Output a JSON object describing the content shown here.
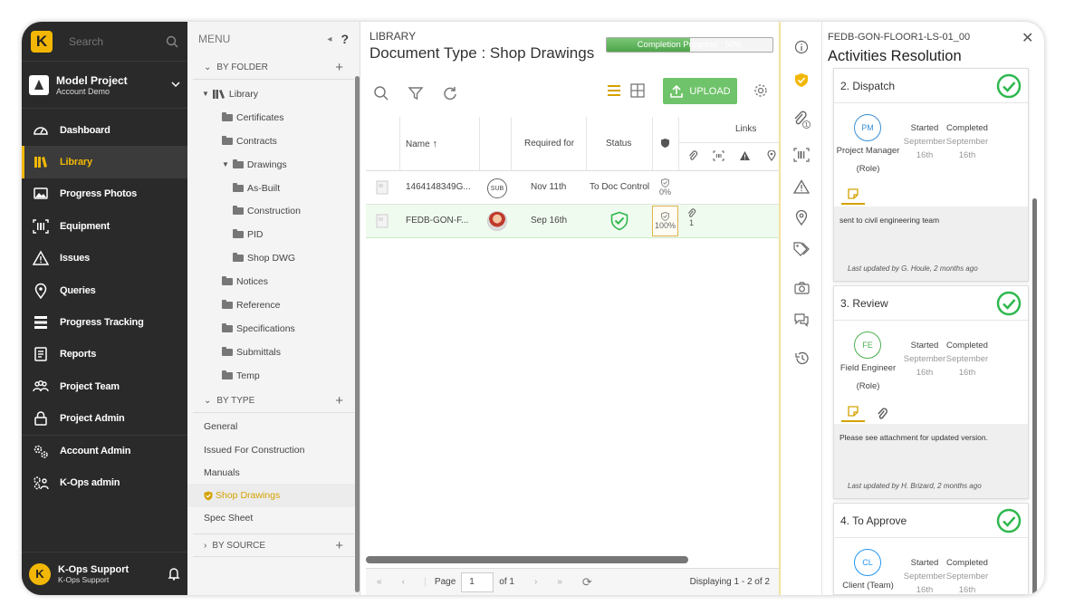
{
  "sidebar": {
    "search_placeholder": "Search",
    "logo_letter": "K",
    "project": {
      "name": "Model Project",
      "account": "Account Demo"
    },
    "items": [
      {
        "label": "Dashboard",
        "icon": "dashboard-icon"
      },
      {
        "label": "Library",
        "icon": "library-icon",
        "active": true
      },
      {
        "label": "Progress Photos",
        "icon": "photos-icon"
      },
      {
        "label": "Equipment",
        "icon": "barcode-icon"
      },
      {
        "label": "Issues",
        "icon": "warning-icon"
      },
      {
        "label": "Queries",
        "icon": "location-pin-icon"
      },
      {
        "label": "Progress Tracking",
        "icon": "tracking-icon"
      },
      {
        "label": "Reports",
        "icon": "report-icon"
      },
      {
        "label": "Project Team",
        "icon": "team-icon"
      },
      {
        "label": "Project Admin",
        "icon": "lock-icon"
      },
      {
        "label": "Account Admin",
        "icon": "gears-icon"
      },
      {
        "label": "K-Ops admin",
        "icon": "gears-users-icon"
      }
    ],
    "footer": {
      "name": "K-Ops Support",
      "sub": "K-Ops Support",
      "avatar": "K"
    }
  },
  "menu": {
    "title": "MENU",
    "help": "?",
    "by_folder": "BY FOLDER",
    "folders": [
      {
        "label": "Library",
        "depth": 0,
        "open": true
      },
      {
        "label": "Certificates",
        "depth": 1
      },
      {
        "label": "Contracts",
        "depth": 1
      },
      {
        "label": "Drawings",
        "depth": 1,
        "open": true
      },
      {
        "label": "As-Built",
        "depth": 2
      },
      {
        "label": "Construction",
        "depth": 2
      },
      {
        "label": "PID",
        "depth": 2
      },
      {
        "label": "Shop DWG",
        "depth": 2
      },
      {
        "label": "Notices",
        "depth": 1
      },
      {
        "label": "Reference",
        "depth": 1
      },
      {
        "label": "Specifications",
        "depth": 1
      },
      {
        "label": "Submittals",
        "depth": 1
      },
      {
        "label": "Temp",
        "depth": 1
      }
    ],
    "by_type": "BY TYPE",
    "types": [
      {
        "label": "General"
      },
      {
        "label": "Issued For Construction"
      },
      {
        "label": "Manuals"
      },
      {
        "label": "Shop Drawings",
        "active": true
      },
      {
        "label": "Spec Sheet"
      }
    ],
    "by_source": "BY SOURCE"
  },
  "library": {
    "label": "LIBRARY",
    "title": "Document Type : Shop Drawings",
    "completion": {
      "label": "Completion Progress : 50%",
      "value": 0.5
    },
    "upload": "UPLOAD",
    "columns": {
      "name": "Name",
      "required_for": "Required for",
      "status": "Status",
      "links": "Links"
    },
    "rows": [
      {
        "name": "1464148349G...",
        "badge": "SUB",
        "required": "Nov 11th",
        "status": "To Doc Control",
        "pct": "0%",
        "links": ""
      },
      {
        "name": "FEDB-GON-F...",
        "badge": "avatar",
        "required": "Sep 16th",
        "status": "approved",
        "pct": "100%",
        "links": "1"
      }
    ],
    "pager": {
      "page_label": "Page",
      "page": "1",
      "of": "of 1",
      "displaying": "Displaying 1 - 2 of 2"
    }
  },
  "activities": {
    "code": "FEDB-GON-FLOOR1-LS-01_00",
    "title": "Activities Resolution",
    "cards": [
      {
        "title": "2. Dispatch",
        "initials": "PM",
        "role": "Project Manager",
        "role_tag": "(Role)",
        "started": "Started",
        "completed": "Completed",
        "d1": "September",
        "d2": "September",
        "d3": "16th",
        "d4": "16th",
        "note": "sent to civil engineering team",
        "updated": "Last updated by G. Houle, 2 months ago"
      },
      {
        "title": "3. Review",
        "initials": "FE",
        "role": "Field Engineer",
        "role_tag": "(Role)",
        "started": "Started",
        "completed": "Completed",
        "d1": "September",
        "d2": "September",
        "d3": "16th",
        "d4": "16th",
        "note": "Please see attachment for updated version.",
        "updated": "Last updated by H. Brizard, 2 months ago"
      },
      {
        "title": "4. To Approve",
        "initials": "CL",
        "role": "Client (Team)",
        "started": "Started",
        "completed": "Completed",
        "d1": "September",
        "d2": "September",
        "d3": "16th",
        "d4": "16th"
      }
    ]
  },
  "colors": {
    "accent": "#f2b705",
    "success": "#2fb84f",
    "sidebar": "#2a2a2a",
    "upload": "#6fc36a"
  }
}
